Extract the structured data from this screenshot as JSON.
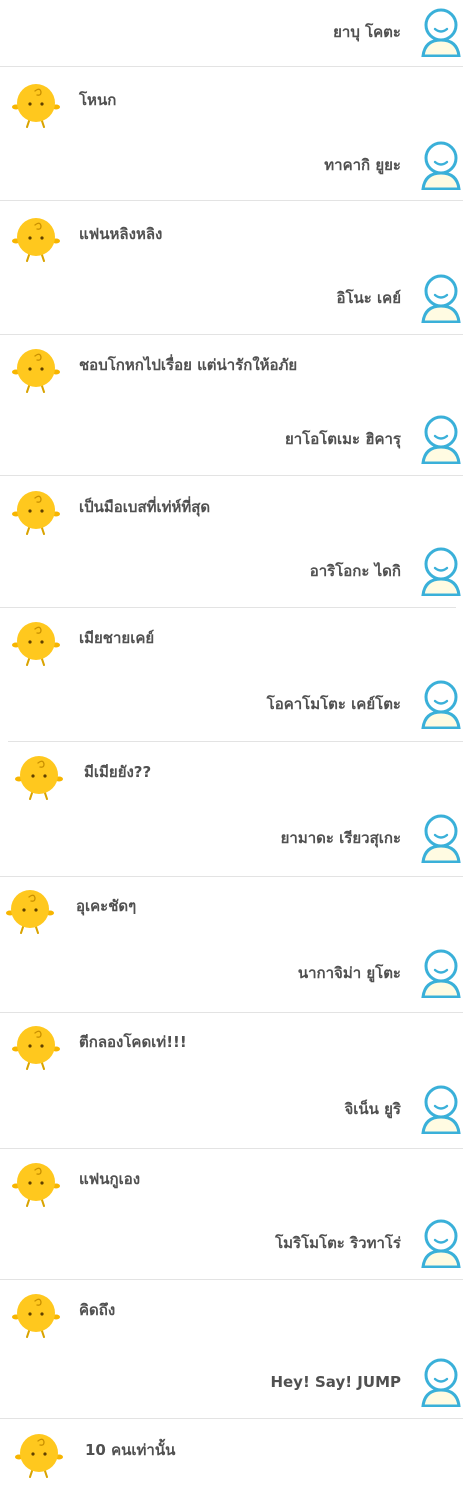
{
  "conversation": [
    {
      "role": "user",
      "text": "ยาบุ โคตะ"
    },
    {
      "role": "bot",
      "text": "โหนก"
    },
    {
      "role": "user",
      "text": "ทาคากิ ยูยะ"
    },
    {
      "role": "bot",
      "text": "แฟนหลิงหลิง"
    },
    {
      "role": "user",
      "text": "อิโนะ เคย์"
    },
    {
      "role": "bot",
      "text": "ชอบโกหกไปเรื่อย แต่น่ารักให้อภัย"
    },
    {
      "role": "user",
      "text": "ยาโอโตเมะ ฮิคารุ"
    },
    {
      "role": "bot",
      "text": "เป็นมือเบสที่เท่ห์ที่สุด"
    },
    {
      "role": "user",
      "text": "อาริโอกะ ไดกิ"
    },
    {
      "role": "bot",
      "text": "เมียชายเคย์"
    },
    {
      "role": "user",
      "text": "โอคาโมโตะ เคย์โตะ"
    },
    {
      "role": "bot",
      "text": "มีเมียยัง??"
    },
    {
      "role": "user",
      "text": "ยามาดะ เรียวสุเกะ"
    },
    {
      "role": "bot",
      "text": "อุเคะชัดๆ"
    },
    {
      "role": "user",
      "text": "นากาจิม่า ยูโตะ"
    },
    {
      "role": "bot",
      "text": "ตีกลองโคดเท่!!!"
    },
    {
      "role": "user",
      "text": "จิเน็น ยูริ"
    },
    {
      "role": "bot",
      "text": "แฟนกูเอง"
    },
    {
      "role": "user",
      "text": "โมริโมโตะ ริวทาโร่"
    },
    {
      "role": "bot",
      "text": "คิดถึง"
    },
    {
      "role": "user",
      "text": "Hey! Say! JUMP"
    },
    {
      "role": "bot",
      "text": "10 คนเท่านั้น"
    }
  ],
  "colors": {
    "user_icon": "#3ab0d9",
    "bot_icon": "#ffc81e",
    "text": "#505050",
    "separator": "#e3e3e3"
  },
  "icons": {
    "user_avatar": "person-outline-icon",
    "bot_avatar": "yellow-chick-icon"
  }
}
